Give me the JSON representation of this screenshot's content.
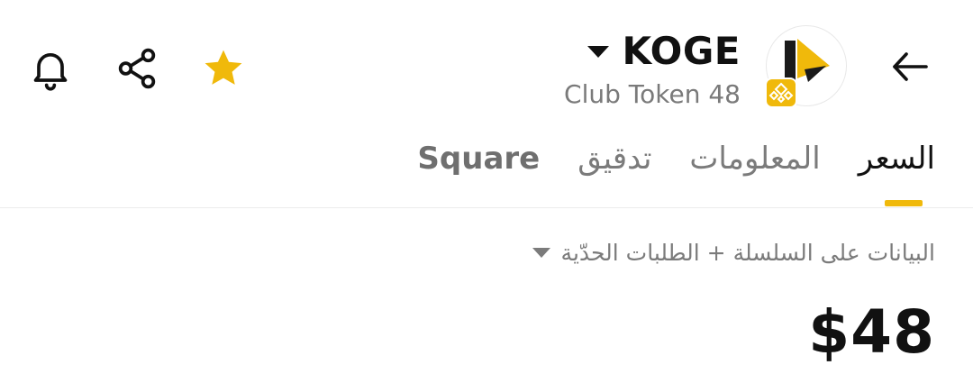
{
  "header": {
    "token": {
      "name": "KOGE",
      "subtitle": "Club Token 48"
    },
    "icons": {
      "back": "arrow-left-icon",
      "favorite": "star-icon",
      "share": "share-icon",
      "notifications": "bell-icon"
    },
    "colors": {
      "accent": "#F0B90B",
      "text": "#111111",
      "muted": "#7B7B7B"
    }
  },
  "tabs": [
    {
      "label": "السعر",
      "active": true
    },
    {
      "label": "المعلومات",
      "active": false
    },
    {
      "label": "تدقيق",
      "active": false
    },
    {
      "label": "Square",
      "active": false
    }
  ],
  "data_source": {
    "label": "البيانات على السلسلة + الطلبات الحدّية"
  },
  "price": {
    "value": "$48"
  }
}
